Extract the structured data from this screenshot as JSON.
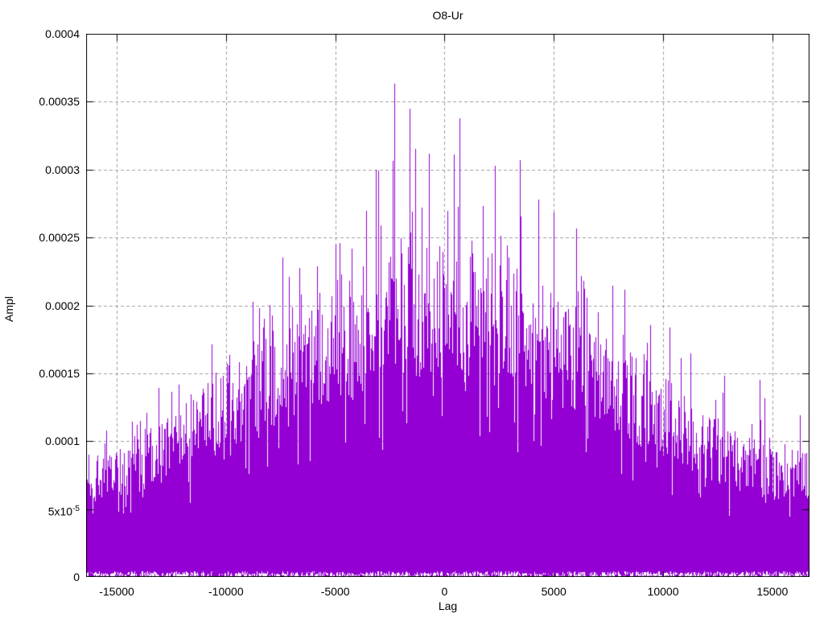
{
  "chart": {
    "title": "O8-Ur",
    "xlabel": "Lag",
    "ylabel": "Ampl"
  },
  "chart_data": {
    "type": "impulse",
    "title": "O8-Ur",
    "xlabel": "Lag",
    "ylabel": "Ampl",
    "xlim": [
      -16400,
      16700
    ],
    "ylim": [
      0,
      0.0004
    ],
    "grid": true,
    "legend": "none",
    "series_color": "#9400d3",
    "grid_color": "#a0a0a0",
    "xticks": [
      {
        "value": -15000,
        "label": "-15000"
      },
      {
        "value": -10000,
        "label": "-10000"
      },
      {
        "value": -5000,
        "label": "-5000"
      },
      {
        "value": 0,
        "label": "0"
      },
      {
        "value": 5000,
        "label": "5000"
      },
      {
        "value": 10000,
        "label": "10000"
      },
      {
        "value": 15000,
        "label": "15000"
      }
    ],
    "yticks": [
      {
        "value": 0,
        "label": "0"
      },
      {
        "value": 5e-05,
        "label": "5x10^-5"
      },
      {
        "value": 0.0001,
        "label": "0.0001"
      },
      {
        "value": 0.00015,
        "label": "0.00015"
      },
      {
        "value": 0.0002,
        "label": "0.0002"
      },
      {
        "value": 0.00025,
        "label": "0.00025"
      },
      {
        "value": 0.0003,
        "label": "0.0003"
      },
      {
        "value": 0.00035,
        "label": "0.00035"
      },
      {
        "value": 0.0004,
        "label": "0.0004"
      }
    ],
    "envelope": {
      "note": "Dense noisy impulse train (~33000 lags); amplitudes form a broad triangular envelope peaking near lag 0. bulk_top = typical top of the dense mass; spike_max = tallest isolated spikes; dense solid mass reaches ~62% of bulk_top; sparse low spikes (< 1e-5) sit along the baseline.",
      "lags": [
        -16400,
        -15000,
        -12500,
        -10000,
        -7500,
        -5000,
        -3500,
        -2000,
        0,
        1000,
        2500,
        5000,
        7500,
        10000,
        12500,
        15000,
        16700
      ],
      "bulk_top": [
        8.5e-05,
        9e-05,
        0.000115,
        0.00015,
        0.000175,
        0.0002,
        0.000215,
        0.00023,
        0.000235,
        0.00023,
        0.00022,
        0.0002,
        0.00017,
        0.00014,
        0.00011,
        9e-05,
        9e-05
      ],
      "spike_max": [
        0.000115,
        0.00012,
        0.00015,
        0.000195,
        0.000245,
        0.000275,
        0.0003,
        0.000363,
        0.000335,
        0.00034,
        0.00031,
        0.000285,
        0.000245,
        0.0002,
        0.000155,
        0.00016,
        0.00013
      ]
    },
    "peaks": [
      {
        "lag": -3150,
        "ampl": 0.0003
      },
      {
        "lag": -2315,
        "ampl": 0.000363
      },
      {
        "lag": -1590,
        "ampl": 0.000345
      },
      {
        "lag": -710,
        "ampl": 0.000312
      },
      {
        "lag": 680,
        "ampl": 0.000338
      },
      {
        "lag": 2310,
        "ampl": 0.000303
      },
      {
        "lag": 3450,
        "ampl": 0.000307
      },
      {
        "lag": 16650,
        "ampl": 0.00012
      }
    ],
    "noise_floor_max": 1e-05
  }
}
